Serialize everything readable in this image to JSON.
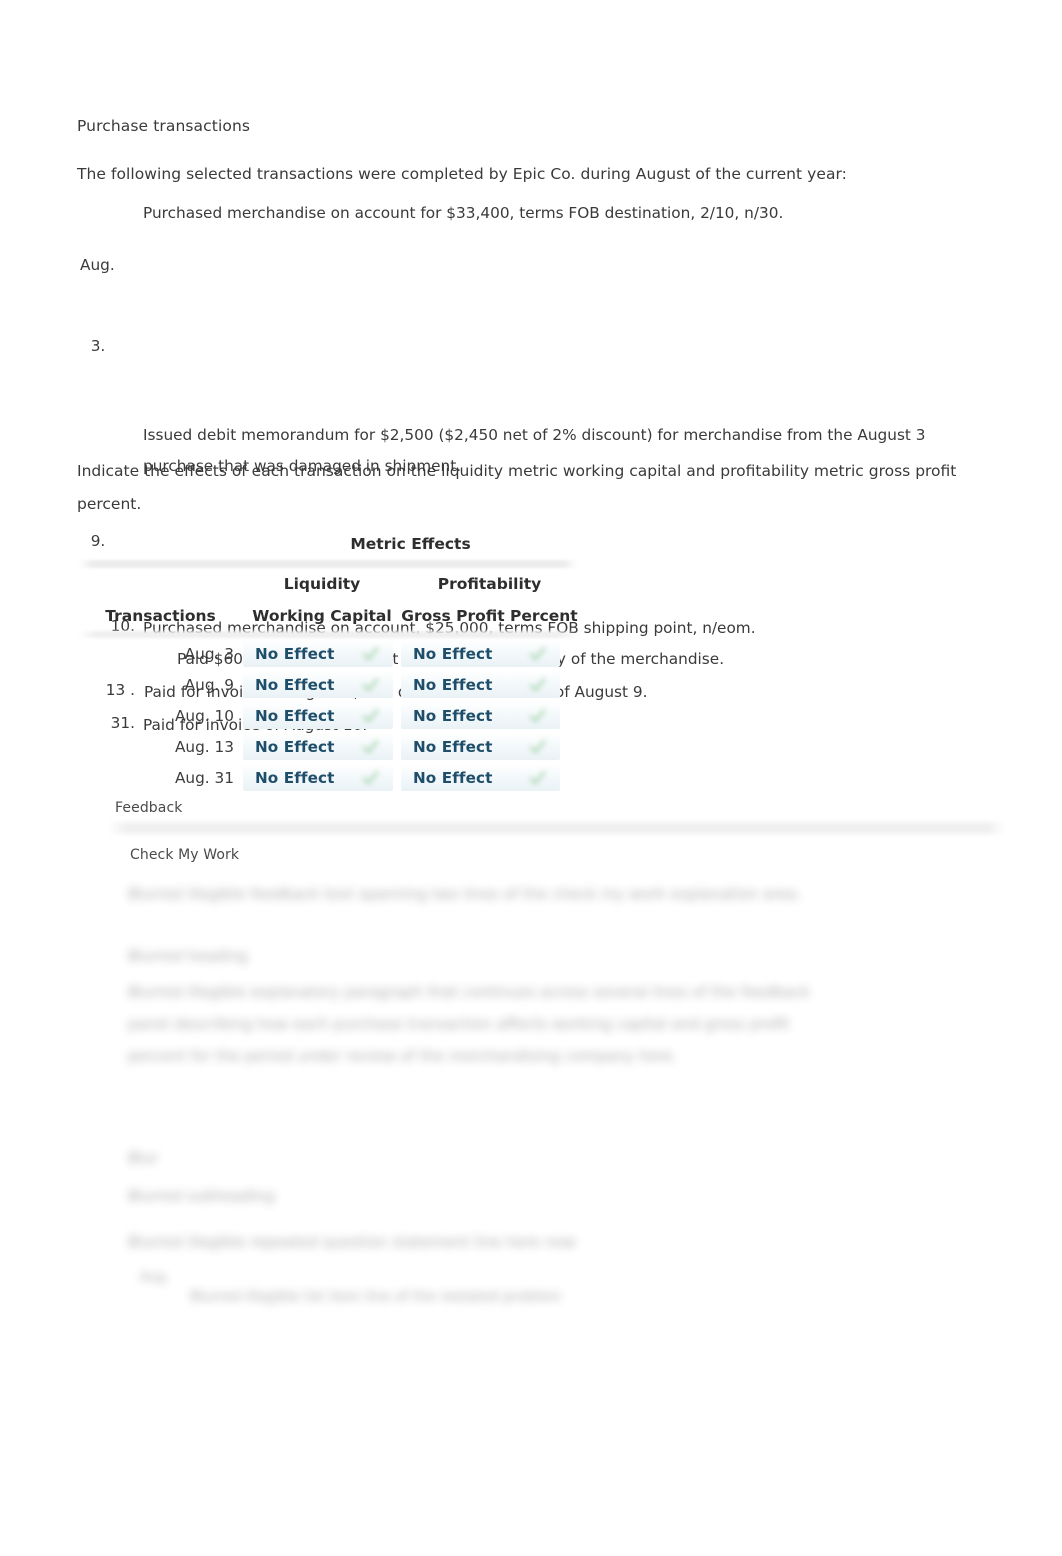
{
  "question": {
    "title": "Purchase transactions",
    "intro": "The following selected transactions were completed by Epic Co. during August of the current year:",
    "transactions": [
      {
        "month": "Aug.",
        "day": "3.",
        "text": "Purchased merchandise on account for $33,400, terms FOB destination, 2/10, n/30."
      },
      {
        "month": "",
        "day": "9.",
        "text": "Issued debit memorandum for $2,500 ($2,450 net of 2% discount) for merchandise from the August 3 purchase that was damaged in shipment."
      },
      {
        "month": "",
        "day": "10.",
        "text": "Purchased merchandise on account, $25,000, terms FOB shipping point, n/eom.",
        "text2": "Paid $600 cash to the freight company for delivery of the merchandise."
      },
      {
        "month": "",
        "day": "13 .",
        "text": "Paid for invoice of August 3, less debit memorandum of August 9."
      },
      {
        "month": "",
        "day": "31.",
        "text": "Paid for invoice of August 10."
      }
    ],
    "instruction": "Indicate the effects of each transaction on the liquidity metric working capital and profitability metric gross profit percent."
  },
  "metric_table": {
    "group_header": "Metric Effects",
    "sub_headers": {
      "liquidity": "Liquidity",
      "profitability": "Profitability"
    },
    "column_headers": {
      "transactions": "Transactions",
      "working_capital": "Working Capital",
      "gross_profit_percent": "Gross Profit Percent"
    },
    "rows": [
      {
        "date": "Aug. 3",
        "working_capital": "No Effect",
        "gross_profit_percent": "No Effect"
      },
      {
        "date": "Aug. 9",
        "working_capital": "No Effect",
        "gross_profit_percent": "No Effect"
      },
      {
        "date": "Aug. 10",
        "working_capital": "No Effect",
        "gross_profit_percent": "No Effect"
      },
      {
        "date": "Aug. 13",
        "working_capital": "No Effect",
        "gross_profit_percent": "No Effect"
      },
      {
        "date": "Aug. 31",
        "working_capital": "No Effect",
        "gross_profit_percent": "No Effect"
      }
    ],
    "colors": {
      "answer_text": "#1f4e6b",
      "header_text": "#2e2e2e",
      "check_green": "#7ec184"
    }
  },
  "feedback": {
    "label": "Feedback",
    "check_my_work": "Check My Work",
    "blurred": {
      "paragraph_1": "Blurred illegible feedback text spanning two lines of the check my work explanation area.",
      "heading_1": "Blurred heading",
      "paragraph_2": "Blurred illegible explanatory paragraph that continues across several lines of the feedback panel describing how each purchase transaction affects working capital and gross profit percent for the period under review of the merchandising company here.",
      "heading_2": "Blur",
      "heading_3": "Blurred subheading",
      "paragraph_3": "Blurred illegible repeated question statement line here now",
      "list_day": "Aug.",
      "list_text": "Blurred illegible list item line of the restated problem"
    }
  }
}
